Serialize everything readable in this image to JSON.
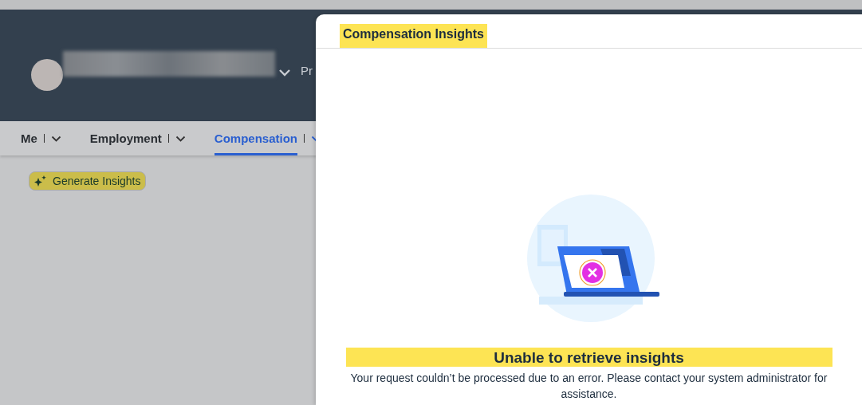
{
  "header": {
    "partial_label": "Pr"
  },
  "tabs": [
    {
      "label": "Me",
      "selected": false
    },
    {
      "label": "Employment",
      "selected": false
    },
    {
      "label": "Compensation",
      "selected": true
    }
  ],
  "generate_button": {
    "label": "Generate Insights"
  },
  "dialog": {
    "title": "Compensation Insights",
    "heading": "Unable to retrieve insights",
    "message": "Your request couldn’t be processed due to an error. Please contact your system administrator for assistance."
  }
}
